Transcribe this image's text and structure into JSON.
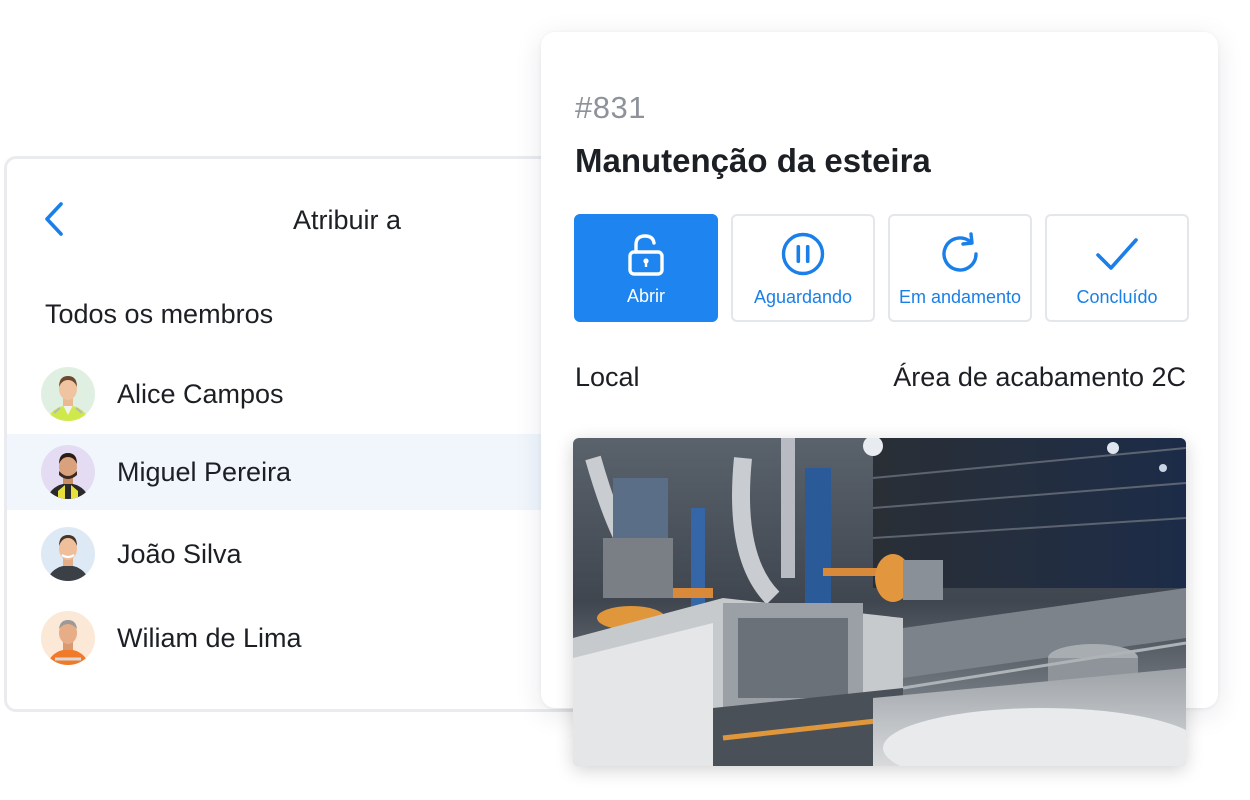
{
  "assign": {
    "title": "Atribuir a",
    "section_label": "Todos os membros",
    "members": [
      {
        "name": "Alice Campos"
      },
      {
        "name": "Miguel Pereira"
      },
      {
        "name": "João Silva"
      },
      {
        "name": "Wiliam de Lima"
      }
    ],
    "selected_index": 1
  },
  "ticket": {
    "number": "#831",
    "title": "Manutenção da esteira",
    "statuses": [
      {
        "label": "Abrir",
        "icon": "unlock-icon",
        "active": true
      },
      {
        "label": "Aguardando",
        "icon": "pause-circle-icon",
        "active": false
      },
      {
        "label": "Em andamento",
        "icon": "refresh-icon",
        "active": false
      },
      {
        "label": "Concluído",
        "icon": "checkmark-icon",
        "active": false
      }
    ],
    "location_label": "Local",
    "location_value": "Área de acabamento 2C"
  },
  "colors": {
    "accent": "#1d84f0",
    "selected_row": "#f1f6fd",
    "muted_text": "#8d929b"
  }
}
